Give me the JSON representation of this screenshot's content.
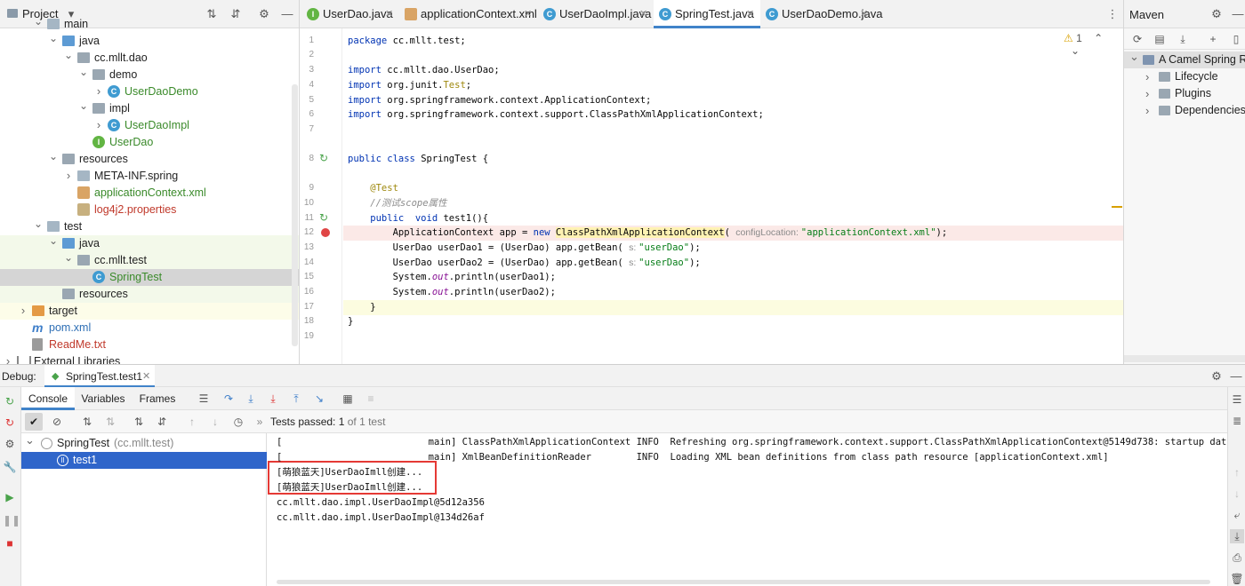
{
  "project": {
    "title": "Project",
    "tree": [
      {
        "label": "main",
        "depth": 2,
        "kind": "folder",
        "expanded": true
      },
      {
        "label": "java",
        "depth": 3,
        "kind": "folder-blue",
        "expanded": true
      },
      {
        "label": "cc.mllt.dao",
        "depth": 4,
        "kind": "package",
        "expanded": true
      },
      {
        "label": "demo",
        "depth": 5,
        "kind": "package",
        "expanded": true
      },
      {
        "label": "UserDaoDemo",
        "depth": 6,
        "kind": "class",
        "color": "green"
      },
      {
        "label": "impl",
        "depth": 5,
        "kind": "package",
        "expanded": true
      },
      {
        "label": "UserDaoImpl",
        "depth": 6,
        "kind": "class",
        "color": "green"
      },
      {
        "label": "UserDao",
        "depth": 5,
        "kind": "interface",
        "color": "green",
        "leaf": true
      },
      {
        "label": "resources",
        "depth": 3,
        "kind": "folder-grey",
        "expanded": true
      },
      {
        "label": "META-INF.spring",
        "depth": 4,
        "kind": "folder",
        "expanded": false
      },
      {
        "label": "applicationContext.xml",
        "depth": 4,
        "kind": "xml",
        "color": "green",
        "leaf": true
      },
      {
        "label": "log4j2.properties",
        "depth": 4,
        "kind": "props",
        "color": "red",
        "leaf": true
      },
      {
        "label": "test",
        "depth": 2,
        "kind": "folder",
        "expanded": true
      },
      {
        "label": "java",
        "depth": 3,
        "kind": "folder-blue",
        "expanded": true,
        "bg": "test"
      },
      {
        "label": "cc.mllt.test",
        "depth": 4,
        "kind": "package",
        "expanded": true,
        "bg": "test"
      },
      {
        "label": "SpringTest",
        "depth": 5,
        "kind": "class",
        "color": "green",
        "leaf": true,
        "selected": true
      },
      {
        "label": "resources",
        "depth": 3,
        "kind": "folder-grey",
        "leaf": true,
        "bg": "test"
      },
      {
        "label": "target",
        "depth": 1,
        "kind": "folder-orange",
        "expanded": false,
        "bg": "y"
      },
      {
        "label": "pom.xml",
        "depth": 1,
        "kind": "maven",
        "color": "blue",
        "leaf": true
      },
      {
        "label": "ReadMe.txt",
        "depth": 1,
        "kind": "text",
        "color": "red",
        "leaf": true
      },
      {
        "label": "External Libraries",
        "depth": 0,
        "kind": "libs",
        "expanded": false
      }
    ]
  },
  "editor": {
    "tabs": [
      {
        "label": "UserDao.java",
        "icon": "I",
        "color": "#62b543",
        "active": false
      },
      {
        "label": "applicationContext.xml",
        "icon": "x",
        "color": "#d9a465",
        "active": false
      },
      {
        "label": "UserDaoImpl.java",
        "icon": "C",
        "color": "#3f9bd1",
        "active": false
      },
      {
        "label": "SpringTest.java",
        "icon": "C",
        "color": "#3f9bd1",
        "active": true
      },
      {
        "label": "UserDaoDemo.java",
        "icon": "C",
        "color": "#3f9bd1",
        "active": false
      }
    ],
    "inspection_count": "1",
    "lines": [
      {
        "n": "1",
        "parts": [
          [
            "kw",
            "package "
          ],
          [
            "",
            "cc.mllt.test;"
          ]
        ]
      },
      {
        "n": "2",
        "parts": []
      },
      {
        "n": "3",
        "parts": [
          [
            "kw",
            "import "
          ],
          [
            "",
            "cc.mllt.dao.UserDao;"
          ]
        ]
      },
      {
        "n": "4",
        "parts": [
          [
            "kw",
            "import "
          ],
          [
            "",
            "org.junit."
          ],
          [
            "ann",
            "Test"
          ],
          [
            "",
            ";"
          ]
        ]
      },
      {
        "n": "5",
        "parts": [
          [
            "kw",
            "import "
          ],
          [
            "",
            "org.springframework.context.ApplicationContext;"
          ]
        ]
      },
      {
        "n": "6",
        "parts": [
          [
            "kw",
            "import "
          ],
          [
            "",
            "org.springframework.context.support.ClassPathXmlApplicationContext;"
          ]
        ]
      },
      {
        "n": "7",
        "parts": []
      },
      {
        "n": "8",
        "parts": [
          [
            "kw",
            "public class "
          ],
          [
            "",
            "SpringTest {"
          ]
        ],
        "gutter": "run"
      },
      {
        "n": "9",
        "parts": []
      },
      {
        "n": "9",
        "parts": [
          [
            "ann",
            "    @Test"
          ]
        ]
      },
      {
        "n": "10",
        "parts": [
          [
            "cmt",
            "    //测试scope属性"
          ]
        ]
      },
      {
        "n": "11",
        "parts": [
          [
            "kw",
            "    public  void "
          ],
          [
            "",
            "test1(){"
          ]
        ],
        "gutter": "run"
      },
      {
        "n": "12",
        "parts": [
          [
            "",
            "        ApplicationContext app = "
          ],
          [
            "kw",
            "new "
          ],
          [
            "hintbg",
            "ClassPathXmlApplicationContext"
          ],
          [
            "",
            "( "
          ],
          [
            "hint",
            "configLocation: "
          ],
          [
            "str",
            "\"applicationContext.xml\""
          ],
          [
            "",
            ");"
          ]
        ],
        "highlight": true,
        "gutter": "break"
      },
      {
        "n": "13",
        "parts": [
          [
            "",
            "        UserDao userDao1 = (UserDao) app.getBean( "
          ],
          [
            "hint",
            "s: "
          ],
          [
            "str",
            "\"userDao\""
          ],
          [
            "",
            ");"
          ]
        ]
      },
      {
        "n": "14",
        "parts": [
          [
            "",
            "        UserDao userDao2 = (UserDao) app.getBean( "
          ],
          [
            "hint",
            "s: "
          ],
          [
            "str",
            "\"userDao\""
          ],
          [
            "",
            ");"
          ]
        ]
      },
      {
        "n": "15",
        "parts": [
          [
            "",
            "        System."
          ],
          [
            "itl",
            "out"
          ],
          [
            "",
            ".println(userDao1);"
          ]
        ]
      },
      {
        "n": "16",
        "parts": [
          [
            "",
            "        System."
          ],
          [
            "itl",
            "out"
          ],
          [
            "",
            ".println(userDao2);"
          ]
        ]
      },
      {
        "n": "17",
        "parts": [
          [
            "",
            "    }"
          ]
        ],
        "current": true
      },
      {
        "n": "18",
        "parts": [
          [
            "",
            "}"
          ]
        ]
      },
      {
        "n": "19",
        "parts": []
      }
    ]
  },
  "maven": {
    "title": "Maven",
    "tree": [
      {
        "label": "A Camel Spring Route",
        "depth": 0,
        "expanded": true,
        "selected": true
      },
      {
        "label": "Lifecycle",
        "depth": 1
      },
      {
        "label": "Plugins",
        "depth": 1
      },
      {
        "label": "Dependencies",
        "depth": 1
      }
    ]
  },
  "debug": {
    "label": "Debug:",
    "session_tab": "SpringTest.test1",
    "tabs": [
      "Console",
      "Variables",
      "Frames"
    ],
    "tests_passed_label": "Tests passed:",
    "tests_passed_value": "1",
    "tests_total": "of 1 test",
    "test_tree": [
      {
        "label": "SpringTest",
        "suffix": "(cc.mllt.test)",
        "depth": 0
      },
      {
        "label": "test1",
        "depth": 1,
        "selected": true
      }
    ],
    "console": [
      "[                          main] ClassPathXmlApplicationContext INFO  Refreshing org.springframework.context.support.ClassPathXmlApplicationContext@5149d738: startup date [Tue Mar",
      "[                          main] XmlBeanDefinitionReader        INFO  Loading XML bean definitions from class path resource [applicationContext.xml]",
      "[萌狼蓝天]UserDaoImll创建...",
      "[萌狼蓝天]UserDaoImll创建...",
      "cc.mllt.dao.impl.UserDaoImpl@5d12a356",
      "cc.mllt.dao.impl.UserDaoImpl@134d26af"
    ]
  },
  "colors": {
    "accent": "#4083c9",
    "highlight_box": "#e53935"
  }
}
